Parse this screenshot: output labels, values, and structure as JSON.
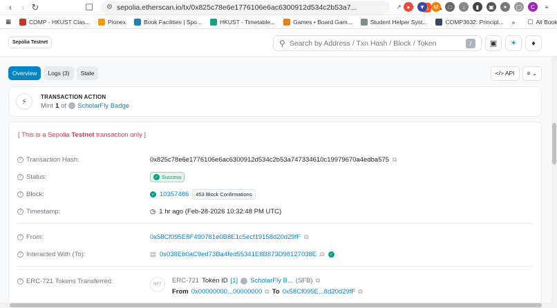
{
  "browser": {
    "url": "sepolia.etherscan.io/tx/0x825c78e6e1776106e6ac6300912d534c2b53a7...",
    "bookmarks": [
      {
        "label": "COMP - HKUST Clas...",
        "color": "#c0392b"
      },
      {
        "label": "Pionex",
        "color": "#f39c12"
      },
      {
        "label": "Book Facilities | Spo...",
        "color": "#2980b9"
      },
      {
        "label": "HKUST - Timetable...",
        "color": "#16a085"
      },
      {
        "label": "Games • Board Gam...",
        "color": "#e67e22"
      },
      {
        "label": "Student Helper Syst...",
        "color": "#7f8c8d"
      },
      {
        "label": "COMP3632: Principl...",
        "color": "#34495e"
      }
    ],
    "all_bookmarks": "All Bookmarks"
  },
  "header": {
    "network": "Sepolia Testnet",
    "search_placeholder": "Search by Address / Txn Hash / Block / Token",
    "slash": "/"
  },
  "tabs": {
    "overview": "Overview",
    "logs": "Logs (3)",
    "state": "State",
    "api": "API"
  },
  "action": {
    "title": "TRANSACTION ACTION",
    "mint": "Mint",
    "count": "1",
    "of": "of",
    "token": "ScholarFly Badge"
  },
  "details": {
    "warn_prefix": "[ This is a Sepolia ",
    "warn_bold": "Testnet",
    "warn_suffix": " transaction only ]",
    "hash_label": "Transaction Hash:",
    "hash": "0x825c78e6e1776106e6ac6300912d534c2b53a747334610c19979670a4edba575",
    "status_label": "Status:",
    "status": "Success",
    "block_label": "Block:",
    "block": "10357486",
    "confirmations": "453 Block Confirmations",
    "timestamp_label": "Timestamp:",
    "timestamp": "1 hr ago (Feb-28-2026 10:32:48 PM UTC)",
    "from_label": "From:",
    "from": "0x58Cf095E8F490781e0B8E1c5ecf19158d20d29fF",
    "to_label": "Interacted With (To):",
    "to": "0x038Eb0aC9ed73Ba4fed55341E8B873D98127038E",
    "erc_label": "ERC-721 Tokens Transferred:",
    "erc_type": "ERC-721",
    "token_id_label": "Token ID",
    "token_id": "[1]",
    "erc_token": "ScholarFly B...",
    "erc_symbol": "(SFB)",
    "erc_from_label": "From",
    "erc_from": "0x00000000...00000000",
    "erc_to_label": "To",
    "erc_to": "0x58Cf095E...8d20d29fF",
    "nft": "NFT"
  }
}
